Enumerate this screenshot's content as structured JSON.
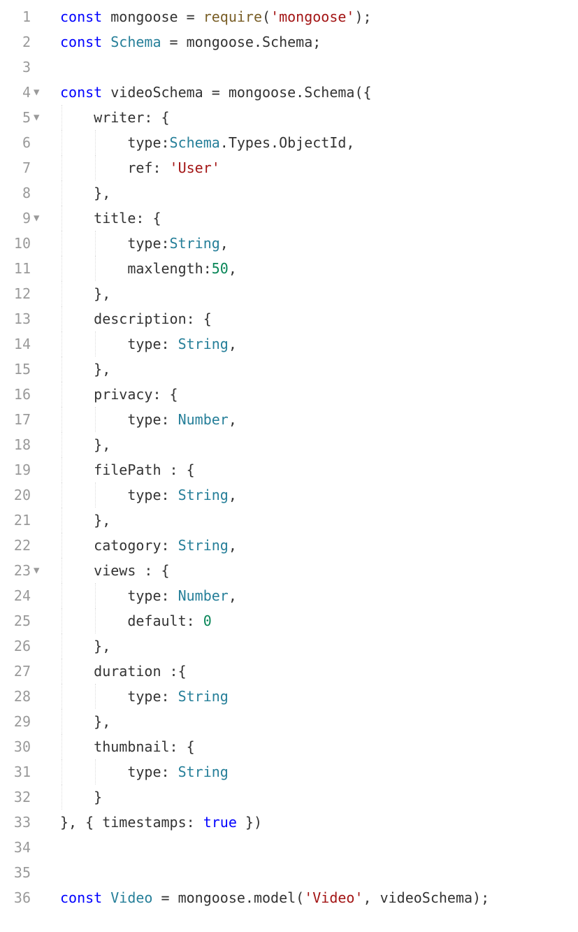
{
  "lines": [
    {
      "num": "1",
      "fold": "",
      "indent": 0,
      "tokens": [
        {
          "t": "const ",
          "c": "keyword"
        },
        {
          "t": "mongoose ",
          "c": "default"
        },
        {
          "t": "= ",
          "c": "operator"
        },
        {
          "t": "require",
          "c": "function"
        },
        {
          "t": "(",
          "c": "punctuation"
        },
        {
          "t": "'mongoose'",
          "c": "string"
        },
        {
          "t": ");",
          "c": "punctuation"
        }
      ]
    },
    {
      "num": "2",
      "fold": "",
      "indent": 0,
      "tokens": [
        {
          "t": "const ",
          "c": "keyword"
        },
        {
          "t": "Schema ",
          "c": "type"
        },
        {
          "t": "= ",
          "c": "operator"
        },
        {
          "t": "mongoose.Schema;",
          "c": "default"
        }
      ]
    },
    {
      "num": "3",
      "fold": "",
      "indent": 0,
      "tokens": []
    },
    {
      "num": "4",
      "fold": "▼",
      "indent": 0,
      "tokens": [
        {
          "t": "const ",
          "c": "keyword"
        },
        {
          "t": "videoSchema ",
          "c": "default"
        },
        {
          "t": "= ",
          "c": "operator"
        },
        {
          "t": "mongoose.Schema({",
          "c": "default"
        }
      ]
    },
    {
      "num": "5",
      "fold": "▼",
      "indent": 1,
      "tokens": [
        {
          "t": "    writer: {",
          "c": "default"
        }
      ]
    },
    {
      "num": "6",
      "fold": "",
      "indent": 2,
      "tokens": [
        {
          "t": "        type:",
          "c": "default"
        },
        {
          "t": "Schema",
          "c": "type"
        },
        {
          "t": ".Types.ObjectId,",
          "c": "default"
        }
      ]
    },
    {
      "num": "7",
      "fold": "",
      "indent": 2,
      "tokens": [
        {
          "t": "        ref: ",
          "c": "default"
        },
        {
          "t": "'User'",
          "c": "string"
        }
      ]
    },
    {
      "num": "8",
      "fold": "",
      "indent": 1,
      "tokens": [
        {
          "t": "    },",
          "c": "default"
        }
      ]
    },
    {
      "num": "9",
      "fold": "▼",
      "indent": 1,
      "tokens": [
        {
          "t": "    title: {",
          "c": "default"
        }
      ]
    },
    {
      "num": "10",
      "fold": "",
      "indent": 2,
      "tokens": [
        {
          "t": "        type:",
          "c": "default"
        },
        {
          "t": "String",
          "c": "type"
        },
        {
          "t": ",",
          "c": "default"
        }
      ]
    },
    {
      "num": "11",
      "fold": "",
      "indent": 2,
      "tokens": [
        {
          "t": "        maxlength:",
          "c": "default"
        },
        {
          "t": "50",
          "c": "number"
        },
        {
          "t": ",",
          "c": "default"
        }
      ]
    },
    {
      "num": "12",
      "fold": "",
      "indent": 1,
      "tokens": [
        {
          "t": "    },",
          "c": "default"
        }
      ]
    },
    {
      "num": "13",
      "fold": "",
      "indent": 1,
      "tokens": [
        {
          "t": "    description: {",
          "c": "default"
        }
      ]
    },
    {
      "num": "14",
      "fold": "",
      "indent": 2,
      "tokens": [
        {
          "t": "        type: ",
          "c": "default"
        },
        {
          "t": "String",
          "c": "type"
        },
        {
          "t": ",",
          "c": "default"
        }
      ]
    },
    {
      "num": "15",
      "fold": "",
      "indent": 1,
      "tokens": [
        {
          "t": "    },",
          "c": "default"
        }
      ]
    },
    {
      "num": "16",
      "fold": "",
      "indent": 1,
      "tokens": [
        {
          "t": "    privacy: {",
          "c": "default"
        }
      ]
    },
    {
      "num": "17",
      "fold": "",
      "indent": 2,
      "tokens": [
        {
          "t": "        type: ",
          "c": "default"
        },
        {
          "t": "Number",
          "c": "type"
        },
        {
          "t": ",",
          "c": "default"
        }
      ]
    },
    {
      "num": "18",
      "fold": "",
      "indent": 1,
      "tokens": [
        {
          "t": "    },",
          "c": "default"
        }
      ]
    },
    {
      "num": "19",
      "fold": "",
      "indent": 1,
      "tokens": [
        {
          "t": "    filePath : {",
          "c": "default"
        }
      ]
    },
    {
      "num": "20",
      "fold": "",
      "indent": 2,
      "tokens": [
        {
          "t": "        type: ",
          "c": "default"
        },
        {
          "t": "String",
          "c": "type"
        },
        {
          "t": ",",
          "c": "default"
        }
      ]
    },
    {
      "num": "21",
      "fold": "",
      "indent": 1,
      "tokens": [
        {
          "t": "    },",
          "c": "default"
        }
      ]
    },
    {
      "num": "22",
      "fold": "",
      "indent": 1,
      "tokens": [
        {
          "t": "    catogory: ",
          "c": "default"
        },
        {
          "t": "String",
          "c": "type"
        },
        {
          "t": ",",
          "c": "default"
        }
      ]
    },
    {
      "num": "23",
      "fold": "▼",
      "indent": 1,
      "tokens": [
        {
          "t": "    views : {",
          "c": "default"
        }
      ]
    },
    {
      "num": "24",
      "fold": "",
      "indent": 2,
      "tokens": [
        {
          "t": "        type: ",
          "c": "default"
        },
        {
          "t": "Number",
          "c": "type"
        },
        {
          "t": ",",
          "c": "default"
        }
      ]
    },
    {
      "num": "25",
      "fold": "",
      "indent": 2,
      "tokens": [
        {
          "t": "        default: ",
          "c": "default"
        },
        {
          "t": "0",
          "c": "number"
        }
      ]
    },
    {
      "num": "26",
      "fold": "",
      "indent": 1,
      "tokens": [
        {
          "t": "    },",
          "c": "default"
        }
      ]
    },
    {
      "num": "27",
      "fold": "",
      "indent": 1,
      "tokens": [
        {
          "t": "    duration :{",
          "c": "default"
        }
      ]
    },
    {
      "num": "28",
      "fold": "",
      "indent": 2,
      "tokens": [
        {
          "t": "        type: ",
          "c": "default"
        },
        {
          "t": "String",
          "c": "type"
        }
      ]
    },
    {
      "num": "29",
      "fold": "",
      "indent": 1,
      "tokens": [
        {
          "t": "    },",
          "c": "default"
        }
      ]
    },
    {
      "num": "30",
      "fold": "",
      "indent": 1,
      "tokens": [
        {
          "t": "    thumbnail: {",
          "c": "default"
        }
      ]
    },
    {
      "num": "31",
      "fold": "",
      "indent": 2,
      "tokens": [
        {
          "t": "        type: ",
          "c": "default"
        },
        {
          "t": "String",
          "c": "type"
        }
      ]
    },
    {
      "num": "32",
      "fold": "",
      "indent": 1,
      "tokens": [
        {
          "t": "    }",
          "c": "default"
        }
      ]
    },
    {
      "num": "33",
      "fold": "",
      "indent": 0,
      "tokens": [
        {
          "t": "}, { timestamps: ",
          "c": "default"
        },
        {
          "t": "true",
          "c": "boolean"
        },
        {
          "t": " })",
          "c": "default"
        }
      ]
    },
    {
      "num": "34",
      "fold": "",
      "indent": 0,
      "tokens": []
    },
    {
      "num": "35",
      "fold": "",
      "indent": 0,
      "tokens": []
    },
    {
      "num": "36",
      "fold": "",
      "indent": 0,
      "tokens": [
        {
          "t": "const ",
          "c": "keyword"
        },
        {
          "t": "Video ",
          "c": "type"
        },
        {
          "t": "= ",
          "c": "operator"
        },
        {
          "t": "mongoose.model(",
          "c": "default"
        },
        {
          "t": "'Video'",
          "c": "string"
        },
        {
          "t": ", videoSchema);",
          "c": "default"
        }
      ]
    }
  ]
}
